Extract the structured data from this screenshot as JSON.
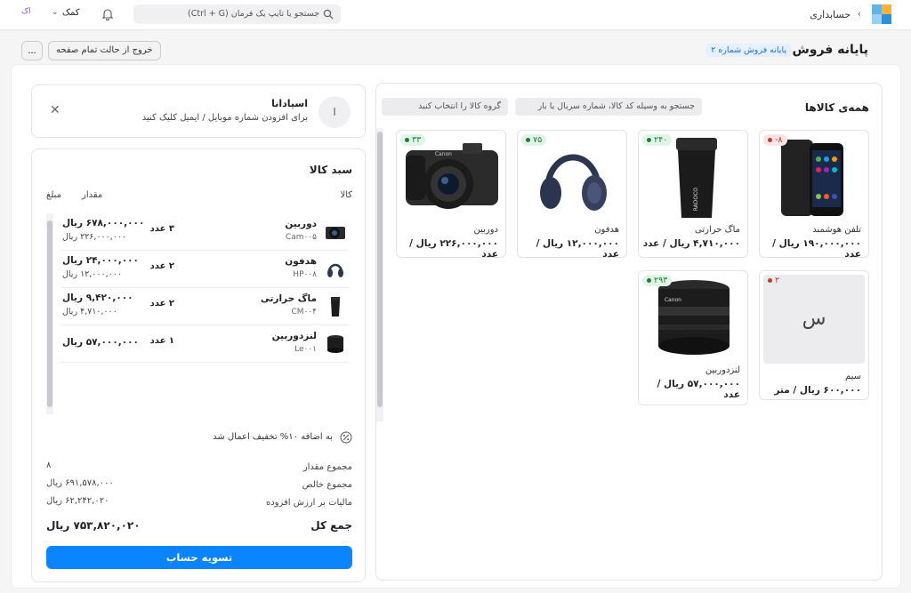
{
  "topbar": {
    "app_name": "حسابداری",
    "search_placeholder": "جستجو یا تایپ یک فرمان (Ctrl + G)",
    "help_label": "کمک",
    "avatar_initials": "اک"
  },
  "header": {
    "title": "پایانه فروش",
    "terminal_badge": "پایانه فروش شماره ۲",
    "exit_fullscreen": "خروج از حالت تمام صفحه",
    "more": "..."
  },
  "catalog": {
    "title": "همه‌ی کالاها",
    "search_placeholder": "جستجو به وسیله کد کالا، شماره سریال یا بار",
    "group_placeholder": "گروه کالا را انتخاب کنید",
    "products": [
      {
        "name": "تلفن هوشمند",
        "price": "۱۹۰,۰۰۰,۰۰۰ ریال / عدد",
        "stock": "-۸",
        "stock_status": "negative",
        "image": "smartphone"
      },
      {
        "name": "ماگ حرارتی",
        "price": "۴,۷۱۰,۰۰۰ ریال / عدد",
        "stock": "۲۴۰",
        "stock_status": "positive",
        "image": "thermal-mug"
      },
      {
        "name": "هدفون",
        "price": "۱۲,۰۰۰,۰۰۰ ریال / عدد",
        "stock": "۷۵",
        "stock_status": "positive",
        "image": "headphones"
      },
      {
        "name": "دوربین",
        "price": "۲۲۶,۰۰۰,۰۰۰ ریال / عدد",
        "stock": "۳۳",
        "stock_status": "positive",
        "image": "camera"
      },
      {
        "name": "سیم",
        "price": "۶۰۰,۰۰۰ ریال / متر",
        "stock": "۲",
        "stock_status": "negative",
        "image": "letter-placeholder",
        "placeholder_letter": "س"
      },
      {
        "name": "لنزدوربین",
        "price": "۵۷,۰۰۰,۰۰۰ ریال / عدد",
        "stock": "۲۹۳",
        "stock_status": "positive",
        "image": "camera-lens"
      }
    ]
  },
  "customer": {
    "avatar_letter": "ا",
    "name": "اسپادانا",
    "hint": "برای افزودن شماره موبایل / ایمیل کلیک کنید"
  },
  "cart": {
    "title": "سبد کالا",
    "col_item": "کالا",
    "col_qty": "مقدار",
    "col_amount": "مبلغ",
    "items": [
      {
        "name": "دوربین",
        "code": "Cam۰۰۵",
        "qty": "۳ عدد",
        "total": "۶۷۸,۰۰۰,۰۰۰ ریال",
        "unit": "۲۲۶,۰۰۰,۰۰۰ ریال",
        "image": "camera"
      },
      {
        "name": "هدفون",
        "code": "HP۰۰۸",
        "qty": "۲ عدد",
        "total": "۲۴,۰۰۰,۰۰۰ ریال",
        "unit": "۱۲,۰۰۰,۰۰۰ ریال",
        "image": "headphones"
      },
      {
        "name": "ماگ حرارتی",
        "code": "CM۰۰۴",
        "qty": "۲ عدد",
        "total": "۹,۴۲۰,۰۰۰ ریال",
        "unit": "۴,۷۱۰,۰۰۰ ریال",
        "image": "thermal-mug"
      },
      {
        "name": "لنزدوربین",
        "code": "Le۰۰۱",
        "qty": "۱ عدد",
        "total": "۵۷,۰۰۰,۰۰۰ ریال",
        "unit": "",
        "image": "camera-lens"
      }
    ],
    "discount_text": "به اضافه ۱۰% تخفیف اعمال شد",
    "total_qty_label": "مجموع مقدار",
    "total_qty": "۸",
    "net_label": "مجموع خالص",
    "net": "۶۹۱,۵۷۸,۰۰۰ ریال",
    "vat_label": "مالیات بر ارزش افزوده",
    "vat": "۶۲,۲۴۲,۰۲۰ ریال",
    "grand_label": "جمع کل",
    "grand": "۷۵۳,۸۲۰,۰۲۰ ریال",
    "checkout_label": "تسویه حساب"
  },
  "colors": {
    "primary": "#0a84ff",
    "positive_stock": "#1e7b3a",
    "negative_stock": "#c0392b",
    "badge_bg": "#e6f0ff"
  }
}
